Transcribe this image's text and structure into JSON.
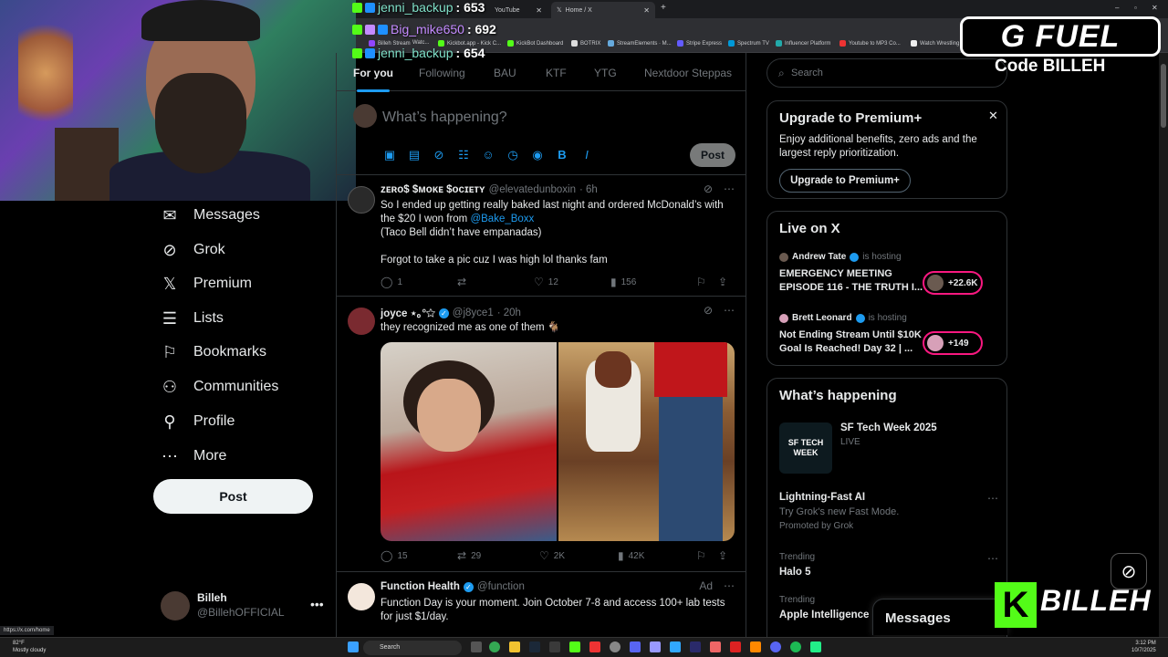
{
  "browser": {
    "tabs": [
      {
        "label": "YouTube",
        "active": false
      },
      {
        "label": "Home / X",
        "active": true
      }
    ],
    "new_tab": "+",
    "bookmarks": [
      "Billeh Stream",
      "Watc...",
      "Kickbot.app - Kick C...",
      "KickBot Dashboard",
      "BOTRIX",
      "StreamElements · M...",
      "Stripe Express",
      "Spectrum TV",
      "Influencer Platform",
      "Youtube to MP3 Co...",
      "Watch Wrestling"
    ],
    "status_url": "https://x.com/home"
  },
  "chat": [
    {
      "name": "jenni_backup",
      "message": ": 653"
    },
    {
      "name": "Big_mike650",
      "message": ": 692"
    },
    {
      "name": "jenni_backup",
      "message": ": 654"
    }
  ],
  "sidebar": {
    "items": [
      {
        "label": "Messages",
        "icon": "mail-icon"
      },
      {
        "label": "Grok",
        "icon": "grok-icon"
      },
      {
        "label": "Premium",
        "icon": "x-logo-icon"
      },
      {
        "label": "Lists",
        "icon": "list-icon"
      },
      {
        "label": "Bookmarks",
        "icon": "bookmark-icon"
      },
      {
        "label": "Communities",
        "icon": "communities-icon"
      },
      {
        "label": "Profile",
        "icon": "person-icon"
      },
      {
        "label": "More",
        "icon": "more-circle-icon"
      }
    ],
    "post_label": "Post",
    "account": {
      "name": "Billeh",
      "handle": "@BillehOFFICIAL"
    }
  },
  "feed": {
    "tabs": [
      "For you",
      "Following",
      "BAU",
      "KTF",
      "YTG",
      "Nextdoor Steppas"
    ],
    "composer_placeholder": "What’s happening?",
    "composer_post": "Post",
    "tweets": [
      {
        "name": "ᴢᴇʀᴏ$ $ᴍᴏᴋᴇ $ᴏᴄɪᴇᴛʏ",
        "handle": "@elevatedunboxin",
        "time": "· 6h",
        "lines": [
          "So I ended up getting really baked last night and ordered McDonald’s with",
          "the $20 I won from",
          "@Bake_Boxx",
          "(Taco Bell didn’t have empanadas)",
          "Forgot to take a pic cuz I was high lol thanks fam"
        ],
        "replies": "1",
        "reposts": "",
        "likes": "12",
        "views": "156"
      },
      {
        "name": "joyce ⋆｡°✩",
        "handle": "@j8yce1",
        "time": "· 20h",
        "text": "they recognized me as one of them 🐐",
        "replies": "15",
        "reposts": "29",
        "likes": "2K",
        "views": "42K"
      },
      {
        "name": "Function Health",
        "handle": "@function",
        "ad": "Ad",
        "text": "Function Day is your moment. Join October 7-8 and access 100+ lab tests for just $1/day."
      }
    ]
  },
  "right": {
    "search_placeholder": "Search",
    "premium": {
      "title": "Upgrade to Premium+",
      "desc": "Enjoy additional benefits, zero ads and the largest reply prioritization.",
      "button": "Upgrade to Premium+"
    },
    "live": {
      "title": "Live on X",
      "items": [
        {
          "name": "Andrew Tate",
          "status": "is hosting",
          "title": "EMERGENCY MEETING EPISODE 116 - THE TRUTH I...",
          "count": "+22.6K"
        },
        {
          "name": "Brett Leonard",
          "status": "is hosting",
          "title": "Not Ending Stream Until $10K Goal Is Reached! Day 32 | ...",
          "count": "+149"
        }
      ]
    },
    "whats_happening": {
      "title": "What’s happening",
      "event": {
        "title": "SF Tech Week 2025",
        "status": "LIVE",
        "thumb": "SF TECH WEEK"
      },
      "promo": {
        "title": "Lightning-Fast AI",
        "sub": "Try Grok's new Fast Mode.",
        "promoted": "Promoted by Grok"
      },
      "trends": [
        {
          "meta": "Trending",
          "title": "Halo 5"
        },
        {
          "meta": "Trending",
          "title": "Apple Intelligence"
        }
      ]
    },
    "messages_drawer": "Messages"
  },
  "overlay": {
    "gfuel": "G FUEL",
    "code": "Code BILLEH",
    "kick": "K",
    "billeh": "BILLEH"
  },
  "taskbar": {
    "weather_temp": "82°F",
    "weather_desc": "Mostly cloudy",
    "search": "Search",
    "time": "3:12 PM",
    "date": "10/7/2025"
  }
}
